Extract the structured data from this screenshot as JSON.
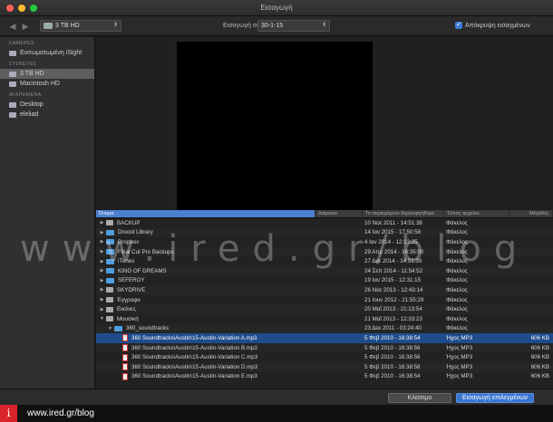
{
  "window": {
    "title": "Εισαγωγή"
  },
  "toolbar": {
    "location": "3 TB HD",
    "import_to_label": "Εισαγωγή σε:",
    "import_to_value": "30-1-15",
    "hide_imported_label": "Απόκρυψη εισαγμένων",
    "hide_imported_checked": true
  },
  "sidebar": {
    "sections": [
      {
        "title": "ΚΑΜΕΡΕΣ",
        "items": [
          {
            "label": "Ενσωματωμένη iSight",
            "icon": "camera-icon",
            "selected": false
          }
        ]
      },
      {
        "title": "ΣΥΣΚΕΥΕΣ",
        "items": [
          {
            "label": "3 TB HD",
            "icon": "drive-icon",
            "selected": true
          },
          {
            "label": "Macintosh HD",
            "icon": "drive-icon",
            "selected": false
          }
        ]
      },
      {
        "title": "ΑΓΑΠΗΜΕΝΑ",
        "items": [
          {
            "label": "Desktop",
            "icon": "desktop-icon",
            "selected": false
          },
          {
            "label": "eleliad",
            "icon": "home-icon",
            "selected": false
          }
        ]
      }
    ]
  },
  "columns": [
    "Όνομα",
    "Διάρκεια",
    "Το περιεχόμενο δημιουργήθηκε",
    "Τύπος αρχείου",
    "Μέγεθος"
  ],
  "rows": [
    {
      "name": "BACKUP",
      "kind": "drive",
      "indent": 0,
      "expand": "right",
      "duration": "",
      "created": "10 Νοε 2011 - 14:51:38",
      "type": "Φάκελος",
      "size": ""
    },
    {
      "name": "Droool Library",
      "kind": "folder",
      "indent": 0,
      "expand": "right",
      "duration": "",
      "created": "14 Ιαν 2015 - 17:50:58",
      "type": "Φάκελος",
      "size": ""
    },
    {
      "name": "Dropbox",
      "kind": "folder",
      "indent": 0,
      "expand": "right",
      "duration": "",
      "created": "4 Ιαν 2014 - 12:13:25",
      "type": "Φάκελος",
      "size": ""
    },
    {
      "name": "Final Cut Pro Backups",
      "kind": "folder",
      "indent": 0,
      "expand": "right",
      "duration": "",
      "created": "29 Απρ 2014 - 16:35:00",
      "type": "Φάκελος",
      "size": ""
    },
    {
      "name": "iTunes",
      "kind": "folder",
      "indent": 0,
      "expand": "right",
      "duration": "",
      "created": "27 Δεκ 2014 - 14:51:39",
      "type": "Φάκελος",
      "size": ""
    },
    {
      "name": "KING OF DREAMS",
      "kind": "folder",
      "indent": 0,
      "expand": "right",
      "duration": "",
      "created": "24 Σεπ 2014 - 11:54:52",
      "type": "Φάκελος",
      "size": ""
    },
    {
      "name": "SEFEROY",
      "kind": "folder",
      "indent": 0,
      "expand": "right",
      "duration": "",
      "created": "19 Ιαν 2015 - 12:31:15",
      "type": "Φάκελος",
      "size": ""
    },
    {
      "name": "SKYDRIVE",
      "kind": "drive",
      "indent": 0,
      "expand": "right",
      "duration": "",
      "created": "26 Νοε 2013 - 12:43:14",
      "type": "Φάκελος",
      "size": ""
    },
    {
      "name": "Έγγραφα",
      "kind": "generic",
      "indent": 0,
      "expand": "right",
      "duration": "",
      "created": "21 Ιουν 2012 - 21:55:29",
      "type": "Φάκελος",
      "size": ""
    },
    {
      "name": "Εικόνες",
      "kind": "generic",
      "indent": 0,
      "expand": "right",
      "duration": "",
      "created": "20 Μαΐ 2013 - 21:13:54",
      "type": "Φάκελος",
      "size": ""
    },
    {
      "name": "Μουσική",
      "kind": "generic",
      "indent": 0,
      "expand": "down",
      "duration": "",
      "created": "21 Μαΐ 2013 - 12:33:23",
      "type": "Φάκελος",
      "size": ""
    },
    {
      "name": "360_soundtracks",
      "kind": "folder",
      "indent": 1,
      "expand": "down",
      "duration": "",
      "created": "23 Δεκ 2011 - 03:24:40",
      "type": "Φάκελος",
      "size": ""
    },
    {
      "name": "360 Soundtracks\\Austin\\15-Austin-Variation A.mp3",
      "kind": "mp3",
      "indent": 2,
      "expand": "",
      "duration": "",
      "created": "5 Φεβ 2010 - 16:38:54",
      "type": "Ήχος MP3",
      "size": "606 KB",
      "highlight": true
    },
    {
      "name": "360 Soundtracks\\Austin\\15-Austin-Variation B.mp3",
      "kind": "mp3",
      "indent": 2,
      "expand": "",
      "duration": "",
      "created": "5 Φεβ 2010 - 16:38:56",
      "type": "Ήχος MP3",
      "size": "606 KB"
    },
    {
      "name": "360 Soundtracks\\Austin\\15-Austin-Variation C.mp3",
      "kind": "mp3",
      "indent": 2,
      "expand": "",
      "duration": "",
      "created": "5 Φεβ 2010 - 16:38:56",
      "type": "Ήχος MP3",
      "size": "606 KB"
    },
    {
      "name": "360 Soundtracks\\Austin\\15-Austin-Variation D.mp3",
      "kind": "mp3",
      "indent": 2,
      "expand": "",
      "duration": "",
      "created": "5 Φεβ 2010 - 16:38:58",
      "type": "Ήχος MP3",
      "size": "606 KB"
    },
    {
      "name": "360 Soundtracks\\Austin\\15-Austin-Variation E.mp3",
      "kind": "mp3",
      "indent": 2,
      "expand": "",
      "duration": "",
      "created": "5 Φεβ 2010 - 16:38:54",
      "type": "Ήχος MP3",
      "size": "606 KB"
    }
  ],
  "buttons": {
    "close": "Κλείσιμο",
    "import": "Εισαγωγή επιλεγμένων"
  },
  "watermark": "www.ired.gr/blog",
  "footer": {
    "badge": "i",
    "url": "www.ired.gr/blog"
  },
  "colors": {
    "accent": "#3a76d0",
    "selection": "#1e4c8c",
    "folder": "#4f9fe0",
    "brand_red": "#d8242a"
  }
}
